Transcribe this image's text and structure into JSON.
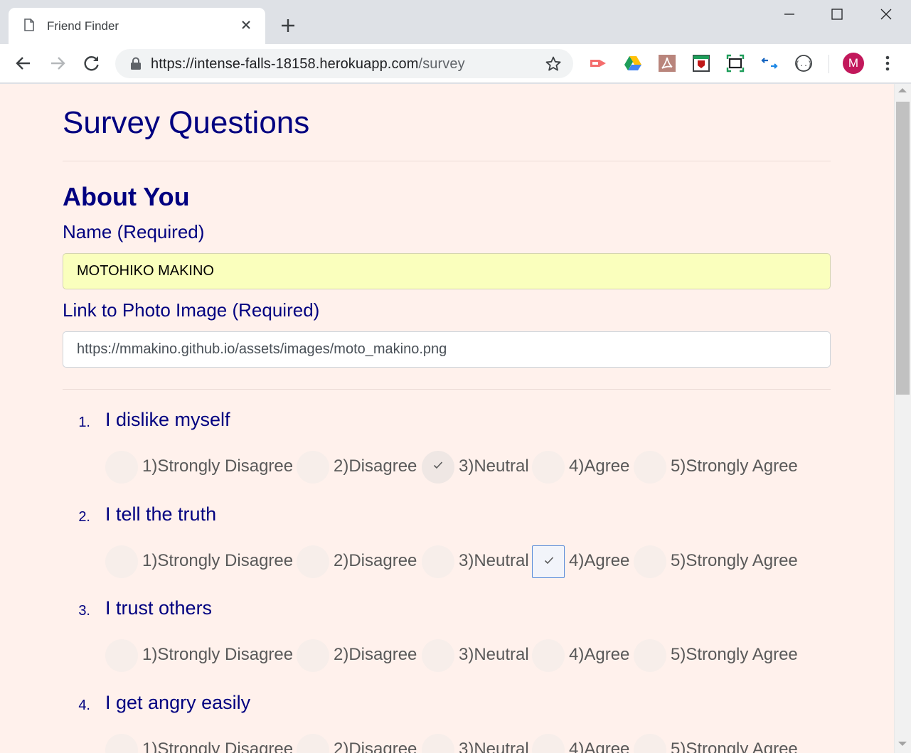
{
  "browser": {
    "tab_title": "Friend Finder",
    "url_host": "https://intense-falls-18158.herokuapp.com",
    "url_path": "/survey",
    "avatar_initial": "M",
    "extensions": [
      "screencastify-icon",
      "google-drive-icon",
      "acrobat-icon",
      "mcafee-icon",
      "screenshot-icon",
      "sync-arrows-icon",
      "json-viewer-icon"
    ]
  },
  "page": {
    "title": "Survey Questions",
    "section_title": "About You",
    "name_label": "Name (Required)",
    "name_value": "MOTOHIKO MAKINO",
    "photo_label": "Link to Photo Image (Required)",
    "photo_value": "https://mmakino.github.io/assets/images/moto_makino.png"
  },
  "options": [
    "1)Strongly Disagree",
    "2)Disagree",
    "3)Neutral",
    "4)Agree",
    "5)Strongly Agree"
  ],
  "questions": [
    {
      "number": "1.",
      "text": "I dislike myself",
      "selected": "3)Neutral"
    },
    {
      "number": "2.",
      "text": "I tell the truth",
      "selected": "4)Agree"
    },
    {
      "number": "3.",
      "text": "I trust others",
      "selected": null
    },
    {
      "number": "4.",
      "text": "I get angry easily",
      "selected": null
    }
  ],
  "colors": {
    "page_bg": "#fff1ec",
    "heading": "#000080",
    "autofill_bg": "#faffbd"
  }
}
